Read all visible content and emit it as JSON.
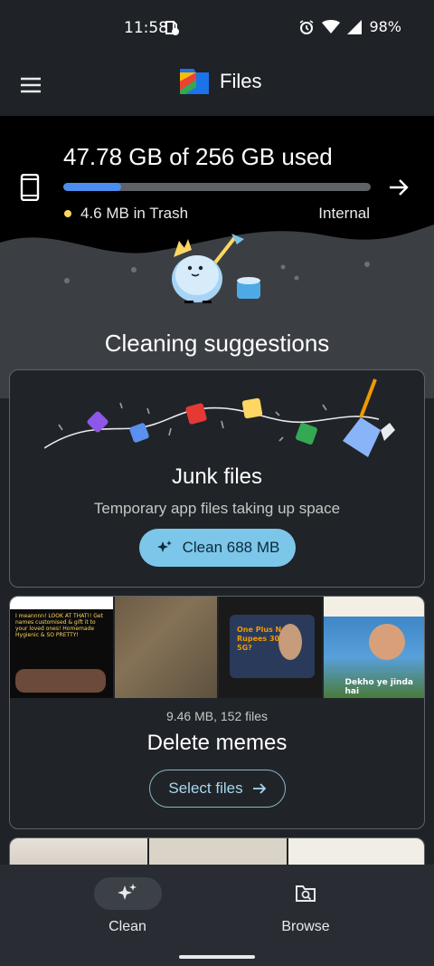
{
  "status_bar": {
    "time": "11:58",
    "battery": "98%",
    "icons": [
      "data-saver-icon",
      "alarm-icon",
      "wifi-icon",
      "signal-icon"
    ]
  },
  "app_bar": {
    "title": "Files",
    "icons": [
      "menu-icon",
      "files-logo-icon"
    ]
  },
  "storage": {
    "used_text": "47.78 GB of 256 GB used",
    "used_fraction": 0.187,
    "trash_text": "4.6 MB in Trash",
    "location": "Internal",
    "bar_color": "#4b8ef0",
    "trash_dot_color": "#fdd663"
  },
  "suggestions": {
    "title": "Cleaning suggestions"
  },
  "junk_card": {
    "title": "Junk files",
    "subtitle": "Temporary app files taking up space",
    "button_label": "Clean 688 MB",
    "button_color": "#7cc6ea"
  },
  "memes_card": {
    "info": "9.46 MB, 152 files",
    "title": "Delete memes",
    "button_label": "Select files",
    "thumbnails": [
      {
        "name": "meme-customised-gifts",
        "text": "I meannnn! LOOK AT THAT!! Get names customised & gift it to your loved ones! Homemade Hygienic & SO PRETTY!"
      },
      {
        "name": "meme-aerial-fields",
        "text": ""
      },
      {
        "name": "meme-oneplus-nord",
        "text": "One Plus Nord Rupees 30000 5G?"
      },
      {
        "name": "meme-dekho-ye-jinda-hai",
        "text": "Dekho ye jinda hai"
      }
    ]
  },
  "bottom_nav": {
    "items": [
      {
        "label": "Clean",
        "icon": "sparkle-icon",
        "active": true
      },
      {
        "label": "Browse",
        "icon": "browse-folder-icon",
        "active": false
      }
    ],
    "active_pill_color": "#3c4148"
  }
}
